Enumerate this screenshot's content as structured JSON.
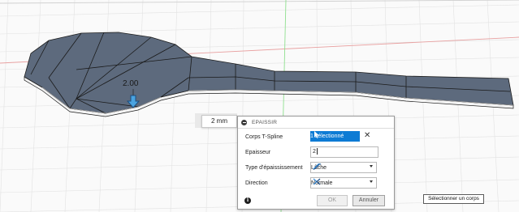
{
  "canvas": {
    "dimension_value": "2.00",
    "dimension_input": "2 mm"
  },
  "panel": {
    "title": "EPAISSIR",
    "rows": {
      "bodies_label": "Corps T-Spline",
      "bodies_selection": "1 sélectionné",
      "thickness_label": "Epaisseur",
      "thickness_value": "2",
      "type_label": "Type d'épaississement",
      "type_value": "Lâche",
      "direction_label": "Direction",
      "direction_value": "Normale"
    },
    "ok_label": "OK",
    "cancel_label": "Annuler"
  },
  "tooltip": "Sélectionner un corps",
  "colors": {
    "accent": "#0d7bd4",
    "body_fill": "#5d6a7d",
    "axis_red": "#e8a0a0",
    "axis_green": "#8fe08f"
  },
  "icons": {
    "info": "info-icon",
    "clear": "close-icon",
    "select": "cursor-icon",
    "type": "thicken-type-icon",
    "direction": "direction-icon",
    "collapse": "collapse-icon",
    "arrow": "thickness-arrow-icon"
  }
}
